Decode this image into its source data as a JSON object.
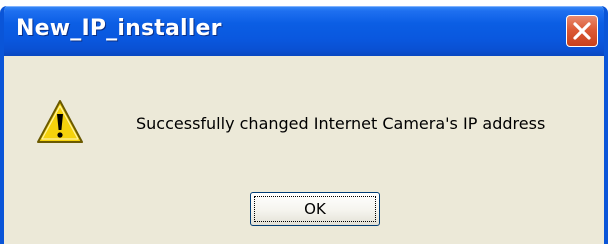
{
  "dialog": {
    "title": "New_IP_installer",
    "message": "Successfully changed Internet Camera's IP address",
    "icon": "warning-icon",
    "buttons": {
      "close_icon": "close-icon",
      "ok_label": "OK"
    }
  },
  "colors": {
    "titlebar": "#0a58df",
    "window_frame": "#0a55d8",
    "dialog_background": "#ece9d8",
    "close_button": "#dc5a36",
    "warning_yellow": "#f5d20c"
  }
}
